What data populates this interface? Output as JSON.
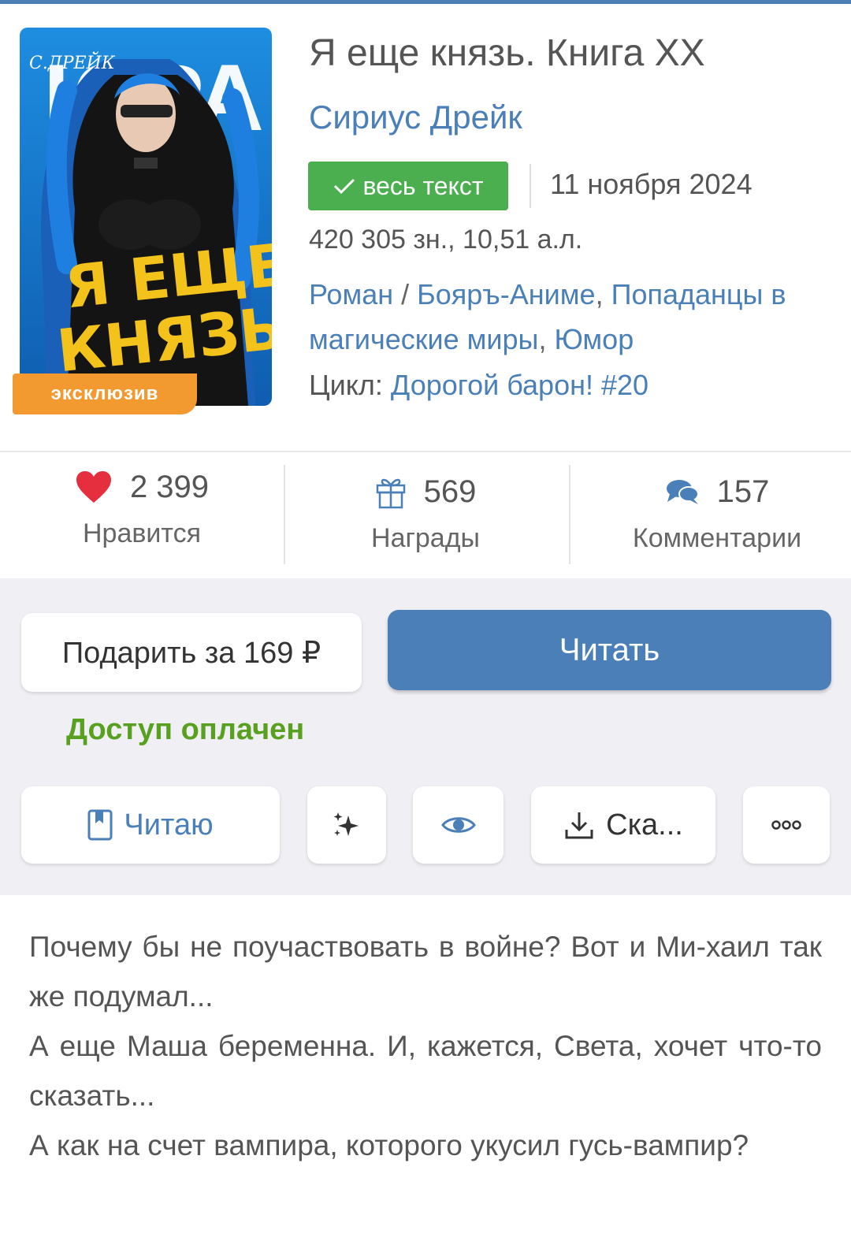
{
  "colors": {
    "accent": "#4a7fb8",
    "success": "#4bae4f",
    "paid": "#5aa020",
    "badge": "#f29a30",
    "like": "#e52f3e",
    "action_bg": "#efeff4"
  },
  "book": {
    "title": "Я еще князь. Книга XX",
    "author": "Сириус Дрейк",
    "status_badge": "весь текст",
    "date": "11 ноября 2024",
    "size": "420 305 зн., 10,51 а.л.",
    "genre_roman": "Роман",
    "genre_sep": " / ",
    "genre_boyar": "Бояръ-Аниме",
    "genre_comma1": ", ",
    "genre_popadancy": "Попаданцы в магические миры",
    "genre_comma2": ", ",
    "genre_humor": "Юмор",
    "cycle_label": "Цикл: ",
    "cycle_name": "Дорогой барон! #20",
    "exclusive_badge": "эксклюзив",
    "cover_text_line1": "Я ЕЩЕ",
    "cover_text_line2": "КНЯЗЬ",
    "cover_signature": "С.ДРЕЙК",
    "cover_series": "ЮРА"
  },
  "stats": {
    "likes": {
      "value": "2 399",
      "label": "Нравится",
      "icon": "heart-icon"
    },
    "awards": {
      "value": "569",
      "label": "Награды",
      "icon": "gift-icon"
    },
    "comments": {
      "value": "157",
      "label": "Комментарии",
      "icon": "comments-icon"
    }
  },
  "actions": {
    "gift": "Подарить за 169 ₽",
    "read": "Читать",
    "paid_status": "Доступ оплачен",
    "reading": "Читаю",
    "download": "Ска...",
    "icons": [
      "bookmark-icon",
      "sparkle-icon",
      "eye-icon",
      "download-icon",
      "more-icon"
    ]
  },
  "annotation": {
    "p1": "Почему бы не поучаствовать в войне? Вот и Ми-хаил так же подумал...",
    "p2": "А еще Маша беременна. И, кажется, Света, хочет что-то сказать...",
    "p3": "А как на счет вампира, которого укусил гусь-вампир?"
  }
}
